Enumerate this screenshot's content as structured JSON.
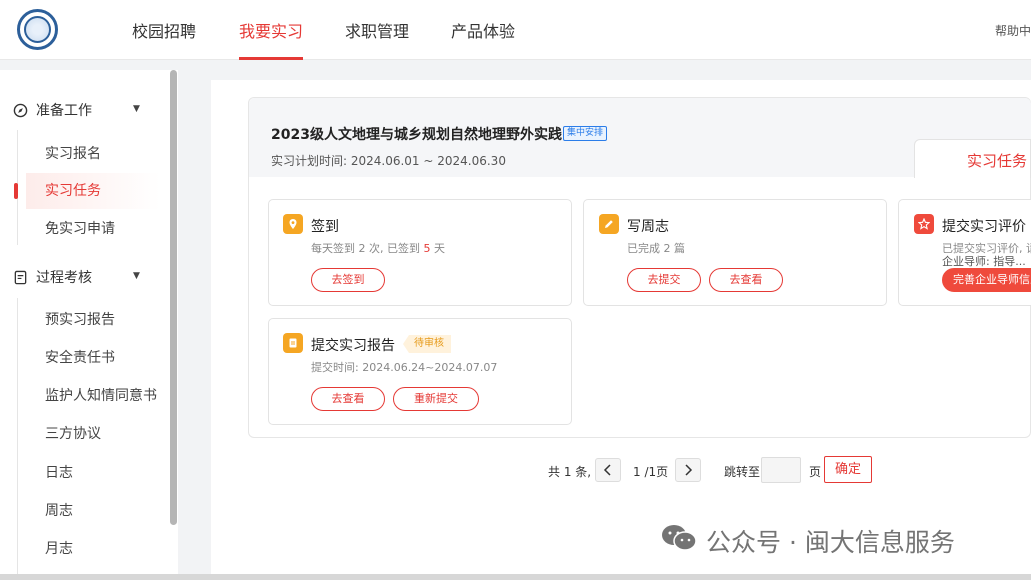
{
  "nav": {
    "items": [
      {
        "label": "校园招聘"
      },
      {
        "label": "我要实习"
      },
      {
        "label": "求职管理"
      },
      {
        "label": "产品体验"
      }
    ],
    "active_index": 1,
    "help": "帮助中心"
  },
  "sidebar": {
    "groups": [
      {
        "label": "准备工作",
        "icon": "compass-icon",
        "items": [
          "实习报名",
          "实习任务",
          "免实习申请"
        ]
      },
      {
        "label": "过程考核",
        "icon": "document-check-icon",
        "items": [
          "预实习报告",
          "安全责任书",
          "监护人知情同意书",
          "三方协议",
          "日志",
          "周志",
          "月志"
        ]
      }
    ],
    "active_item": "实习任务"
  },
  "course": {
    "title": "2023级人文地理与城乡规划自然地理野外实践",
    "badge": "集中安排",
    "plan_time": "实习计划时间: 2024.06.01 ~ 2024.06.30",
    "tab": "实习任务"
  },
  "tasks": {
    "checkin": {
      "title": "签到",
      "icon": "location-pin-icon",
      "desc_prefix": "每天签到 2 次,  已签到 ",
      "desc_count": "5",
      "desc_suffix": " 天",
      "button": "去签到"
    },
    "weekly": {
      "title": "写周志",
      "icon": "pencil-icon",
      "desc": "已完成 2 篇",
      "button1": "去提交",
      "button2": "去查看"
    },
    "evaluation": {
      "title": "提交实习评价",
      "icon": "star-icon",
      "desc1": "已提交实习评价, 请",
      "desc2": "企业导师: 指导...",
      "button": "完善企业导师信息"
    },
    "report": {
      "title": "提交实习报告",
      "icon": "report-icon",
      "status": "待审核",
      "desc": "提交时间: 2024.06.24~2024.07.07",
      "button1": "去查看",
      "button2": "重新提交"
    }
  },
  "pagination": {
    "total": "共 1 条,",
    "page": "1 /1页",
    "jump": "跳转至",
    "page_unit": "页",
    "confirm": "确定"
  },
  "watermark": "公众号 · 闽大信息服务",
  "colors": {
    "accent": "#e53935",
    "orange": "#f5a623",
    "blue_badge": "#2b7de9"
  }
}
